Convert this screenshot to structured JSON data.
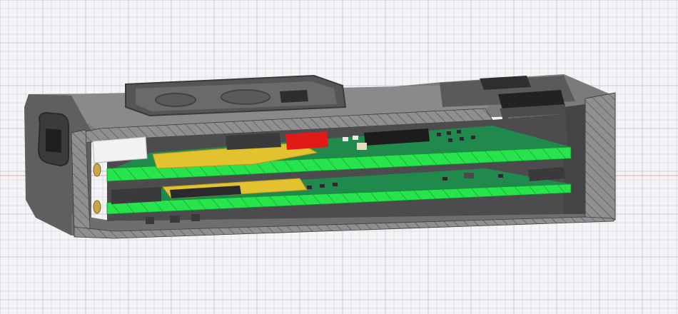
{
  "viewport": {
    "background": "#f3f4f6",
    "grid_minor_color": "#dde0e6",
    "grid_major_color": "#c9cdd6",
    "axis_color": "#f2a6a6"
  },
  "model": {
    "enclosure_color": "#5d5d5f",
    "enclosure_light": "#7a7a7c",
    "section_cap_color": "#8f8f91",
    "pcb_section_color": "#21e046",
    "pcb_top_color": "#1f8a4c",
    "flex_cable_color": "#e2c22e",
    "chip_color": "#1c1c1c",
    "red_part_color": "#e11919",
    "white_connector_color": "#f2f2f2",
    "screw_color": "#c9a64a"
  }
}
